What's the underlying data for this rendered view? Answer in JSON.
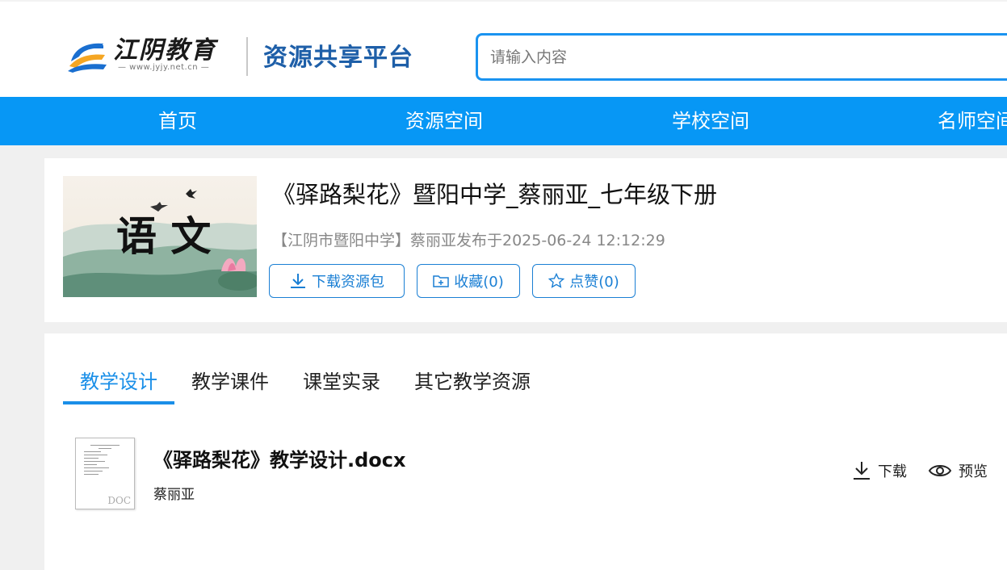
{
  "header": {
    "logo_title": "江阴教育",
    "logo_url": "— www.jyjy.net.cn —",
    "platform_name": "资源共享平台",
    "search_placeholder": "请输入内容"
  },
  "nav": {
    "items": [
      "首页",
      "资源空间",
      "学校空间",
      "名师空间"
    ]
  },
  "resource": {
    "thumbnail_text": "语 文",
    "title": "《驿路梨花》暨阳中学_蔡丽亚_七年级下册",
    "meta": "【江阴市暨阳中学】蔡丽亚发布于2025-06-24 12:12:29",
    "download_label": "下载资源包",
    "collect_label": "收藏(0)",
    "like_label": "点赞(0)"
  },
  "tabs": [
    "教学设计",
    "教学课件",
    "课堂实录",
    "其它教学资源"
  ],
  "files": [
    {
      "icon_label": "DOC",
      "name": "《驿路梨花》教学设计.docx",
      "author": "蔡丽亚",
      "download_label": "下载",
      "preview_label": "预览"
    }
  ],
  "colors": {
    "primary": "#0797f5",
    "accent": "#1a8fe8",
    "logo_blue": "#1e5fa8"
  }
}
